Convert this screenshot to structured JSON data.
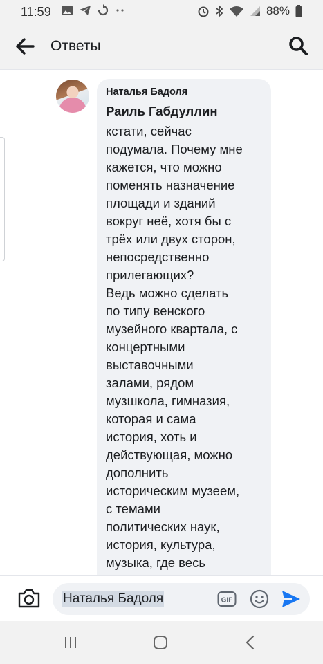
{
  "status_bar": {
    "time": "11:59",
    "battery": "88%",
    "left_icons": [
      "gallery-icon",
      "telegram-icon",
      "sync-icon",
      "more-dots-icon"
    ],
    "right_icons": [
      "alarm-icon",
      "bluetooth-icon",
      "wifi-icon",
      "signal-icon",
      "battery-icon"
    ]
  },
  "header": {
    "title": "Ответы",
    "back_icon": "arrow-left-icon",
    "search_icon": "search-icon"
  },
  "comment": {
    "author": "Наталья Бадоля",
    "mention": "Раиль Габдуллин",
    "text": "кстати, сейчас\nподумала. Почему мне\nкажется, что можно\nпоменять назначение\nплощади и зданий\nвокруг неё, хотя бы с\nтрёх или двух сторон,\nнепосредственно\nприлегающих?\nВедь можно сделать\nпо типу венского\nмузейного квартала, с\nконцертными\nвыставочными\nзалами, рядом\nмузшкола, гимназия,\nкоторая и сама\nистория, хоть и\nдействующая, можно\nдополнить\nисторическим музеем,\nс темами\nполитических наук,\nистория, культура,\nмузыка, где весь"
  },
  "composer": {
    "input_value": "Наталья Бадоля",
    "icons": [
      "camera-icon",
      "gif-icon",
      "emoji-icon",
      "send-icon"
    ]
  },
  "nav_bar": {
    "icons": [
      "recents-icon",
      "home-icon",
      "back-icon"
    ]
  },
  "colors": {
    "accent": "#1877f2",
    "bar_bg": "#f2f2f2",
    "bubble_bg": "#f0f2f5",
    "text": "#1c1e21"
  }
}
